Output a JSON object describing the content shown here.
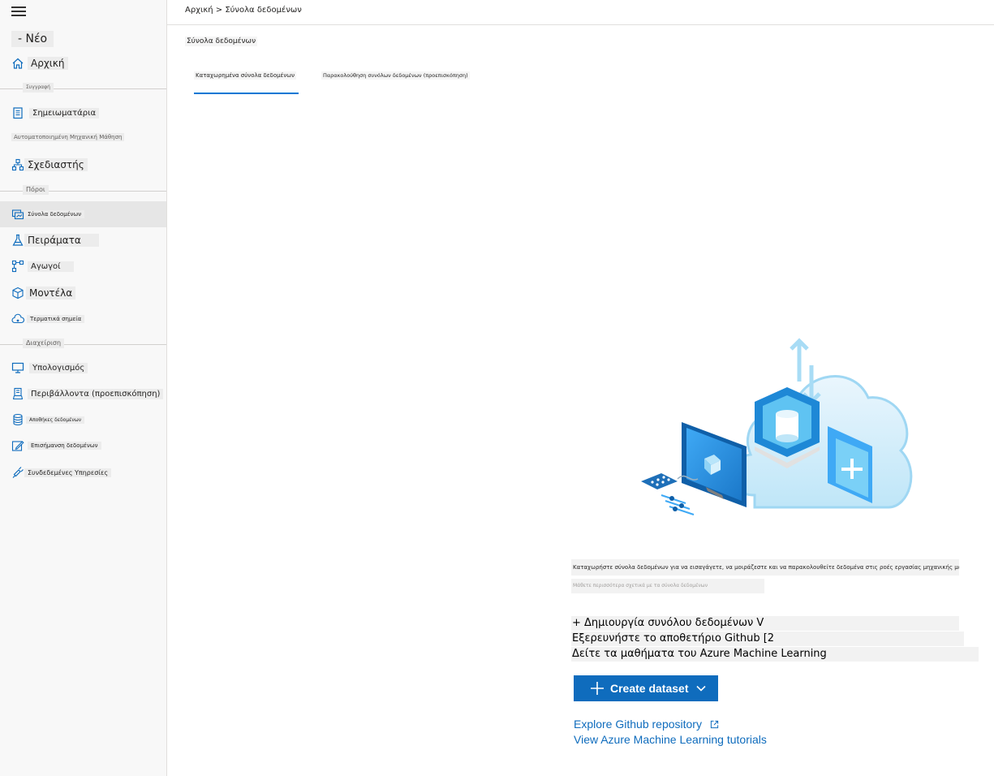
{
  "sidebar": {
    "new_label": "- Νέο",
    "home": "Αρχική",
    "section_author": "Συγγραφή",
    "notebooks": "Σημειωματάρια",
    "automl": "Αυτοματοποιημένη Μηχανική Μάθηση",
    "designer": "Σχεδιαστής",
    "section_assets": "Πόροι",
    "datasets": "Σύνολα δεδομένων",
    "experiments": "Πειράματα",
    "pipelines": "Αγωγοί",
    "models": "Μοντέλα",
    "endpoints": "Τερματικά σημεία",
    "section_manage": "Διαχείριση",
    "compute": "Υπολογισμός",
    "environments": "Περιβάλλοντα (προεπισκόπηση)",
    "datastores": "Αποθήκες δεδομένων",
    "data_labeling": "Επισήμανση δεδομένων",
    "linked_services": "Συνδεδεμένες Υπηρεσίες"
  },
  "breadcrumb": "Αρχική > Σύνολα δεδομένων",
  "page_title": "Σύνολα δεδομένων",
  "tabs": [
    {
      "label": "Καταχωρημένα σύνολα δεδομένων",
      "active": true
    },
    {
      "label": "Παρακολούθηση συνόλων δεδομένων (προεπισκόπηση)",
      "active": false
    }
  ],
  "empty_state": {
    "description": "Καταχωρήστε σύνολα δεδομένων για να εισαγάγετε, να μοιράζεστε και να παρακολουθείτε δεδομένα στις ροές εργασίας μηχανικής μάθησης σας.",
    "description_2": "Μάθετε περισσότερα σχετικά με τα σύνολα δεδομένων",
    "translated_lines": [
      "+ Δημιουργία συνόλου δεδομένων V",
      "Εξερευνήστε το αποθετήριο Github [2",
      "Δείτε τα μαθήματα του Azure Machine Learning"
    ],
    "create_button": "Create dataset",
    "link_github": "Explore Github repository",
    "link_tutorials": "View Azure Machine Learning tutorials"
  },
  "colors": {
    "accent": "#0f6cbd",
    "sidebar_bg": "#f8f8f8",
    "active_item": "#e6e6e6"
  }
}
